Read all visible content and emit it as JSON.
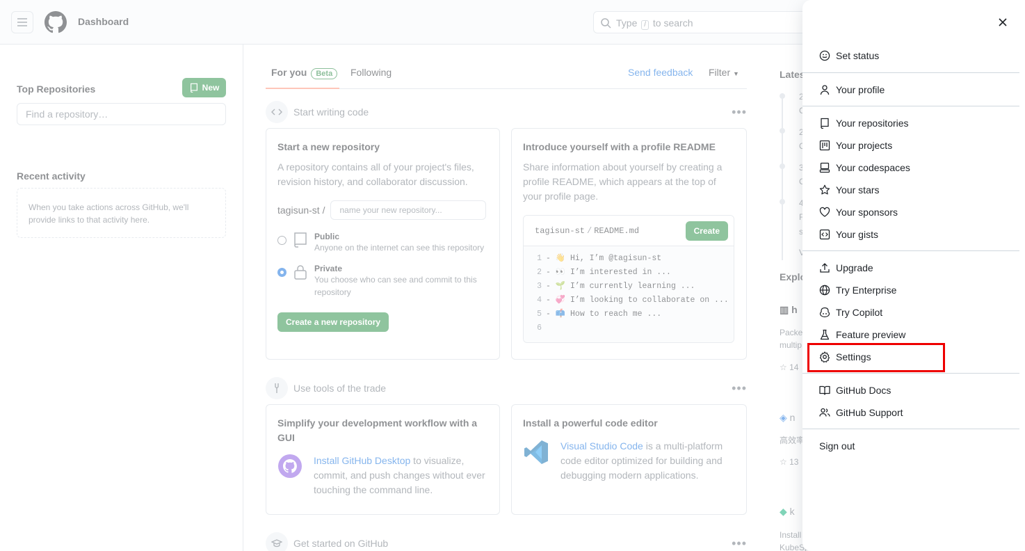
{
  "header": {
    "context_title": "Dashboard",
    "search": {
      "prefix": "Type",
      "kbd": "/",
      "suffix": "to search"
    }
  },
  "sidebar": {
    "top_repositories_label": "Top Repositories",
    "new_button_label": "New",
    "find_repo_placeholder": "Find a repository…",
    "recent_activity_label": "Recent activity",
    "recent_activity_empty": "When you take actions across GitHub, we'll provide links to that activity here."
  },
  "feed": {
    "tabs": [
      {
        "label": "For you",
        "badge": "Beta"
      },
      {
        "label": "Following"
      }
    ],
    "send_feedback": "Send feedback",
    "filter": "Filter",
    "sections": [
      {
        "title": "Start writing code"
      },
      {
        "title": "Use tools of the trade"
      },
      {
        "title": "Get started on GitHub"
      }
    ],
    "new_repo_card": {
      "title": "Start a new repository",
      "desc": "A repository contains all of your project's files, revision history, and collaborator discussion.",
      "owner": "tagisun-st /",
      "repo_name_placeholder": "name your new repository...",
      "public_label": "Public",
      "public_desc": "Anyone on the internet can see this repository",
      "private_label": "Private",
      "private_desc": "You choose who can see and commit to this repository",
      "create_button": "Create a new repository"
    },
    "readme_card": {
      "title": "Introduce yourself with a profile README",
      "desc": "Share information about yourself by creating a profile README, which appears at the top of your profile page.",
      "path_owner": "tagisun-st",
      "path_sep": "/",
      "path_file": "README.md",
      "create_button": "Create",
      "lines": [
        {
          "num": "1",
          "text": "- 👋 Hi, I’m @tagisun-st"
        },
        {
          "num": "2",
          "text": "- 👀 I’m interested in ..."
        },
        {
          "num": "3",
          "text": "- 🌱 I’m currently learning ..."
        },
        {
          "num": "4",
          "text": "- 💞️ I’m looking to collaborate on ..."
        },
        {
          "num": "5",
          "text": "- 📫 How to reach me ..."
        },
        {
          "num": "6",
          "text": ""
        }
      ]
    },
    "desktop_card": {
      "title": "Simplify your development workflow with a GUI",
      "link": "Install GitHub Desktop",
      "text": " to visualize, commit, and push changes without ever touching the command line."
    },
    "editor_card": {
      "title": "Install a powerful code editor",
      "link": "Visual Studio Code",
      "text": " is a multi-platform code editor optimized for building and debugging modern applications."
    }
  },
  "right_column": {
    "latest_label": "Lates",
    "explore_label": "Explo",
    "timeline_fragments": [
      {
        "date": "2",
        "line": "C"
      },
      {
        "date": "2",
        "line": "C"
      },
      {
        "date": "3",
        "line": "C"
      },
      {
        "date": "4",
        "line": "F"
      }
    ],
    "timeline_tail": [
      "s",
      "V"
    ],
    "explore_fragments": [
      {
        "name": "h",
        "desc": "Packer",
        "desc2": "multip",
        "stars": "14"
      },
      {
        "name": "n",
        "desc": "高效率",
        "stars": "13"
      },
      {
        "name": "k",
        "desc": "Install",
        "desc2": "KubeSp"
      }
    ]
  },
  "user_menu": {
    "items": [
      {
        "label": "Set status",
        "icon": "smiley-icon"
      },
      {
        "label": "Your profile",
        "icon": "person-icon"
      },
      {
        "label": "Your repositories",
        "icon": "repo-icon"
      },
      {
        "label": "Your projects",
        "icon": "project-icon"
      },
      {
        "label": "Your codespaces",
        "icon": "codespaces-icon"
      },
      {
        "label": "Your stars",
        "icon": "star-icon"
      },
      {
        "label": "Your sponsors",
        "icon": "heart-icon"
      },
      {
        "label": "Your gists",
        "icon": "code-square-icon"
      },
      {
        "label": "Upgrade",
        "icon": "upload-icon"
      },
      {
        "label": "Try Enterprise",
        "icon": "globe-icon"
      },
      {
        "label": "Try Copilot",
        "icon": "copilot-icon"
      },
      {
        "label": "Feature preview",
        "icon": "beaker-icon"
      },
      {
        "label": "Settings",
        "icon": "gear-icon"
      },
      {
        "label": "GitHub Docs",
        "icon": "book-icon"
      },
      {
        "label": "GitHub Support",
        "icon": "people-icon"
      },
      {
        "label": "Sign out",
        "icon": ""
      }
    ]
  },
  "colors": {
    "primary_green": "#1f883d",
    "link_blue": "#0969da",
    "highlight_red": "#e00000"
  }
}
